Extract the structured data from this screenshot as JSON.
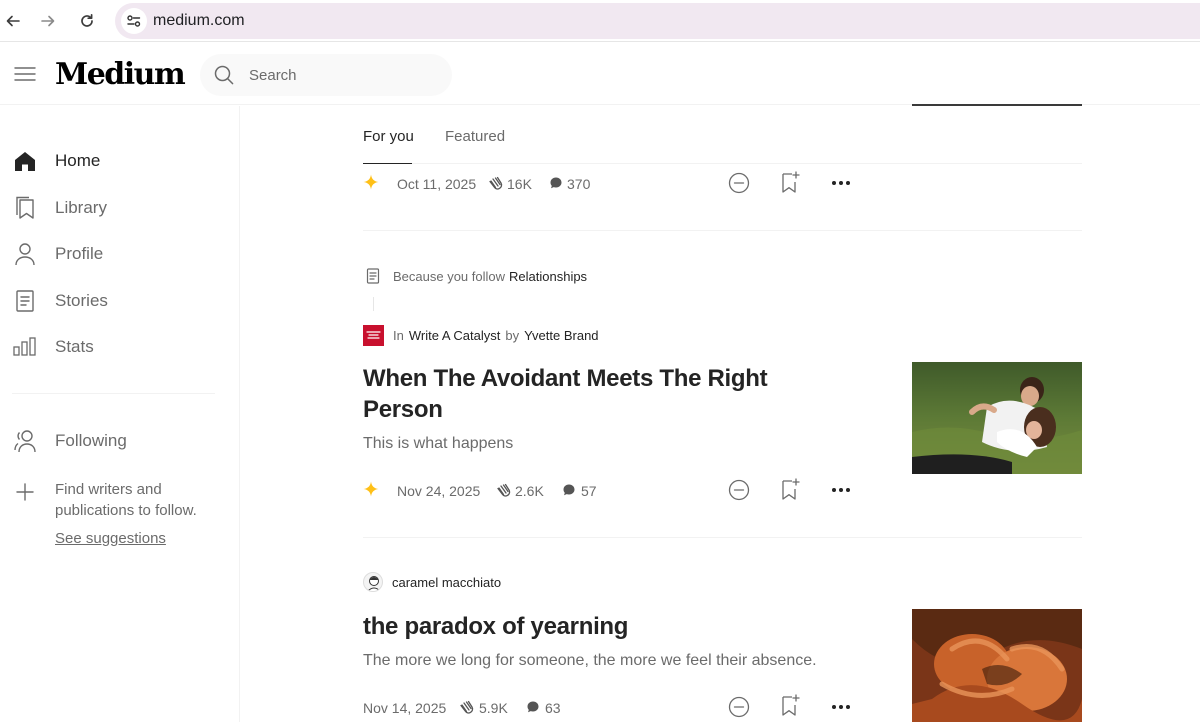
{
  "browser": {
    "url": "medium.com"
  },
  "header": {
    "logo": "Medium",
    "search_placeholder": "Search"
  },
  "sidebar": {
    "items": [
      {
        "label": "Home"
      },
      {
        "label": "Library"
      },
      {
        "label": "Profile"
      },
      {
        "label": "Stories"
      },
      {
        "label": "Stats"
      }
    ],
    "following_label": "Following",
    "find_text": "Find writers and publications to follow.",
    "see_suggestions": "See suggestions"
  },
  "tabs": [
    {
      "label": "For you",
      "active": true
    },
    {
      "label": "Featured",
      "active": false
    }
  ],
  "feed": {
    "top_item": {
      "date": "Oct 11, 2025",
      "claps": "16K",
      "responses": "370"
    },
    "articles": [
      {
        "because_prefix": "Because you follow",
        "because_topic": "Relationships",
        "in_word": "In",
        "publication": "Write A Catalyst",
        "by_word": "by",
        "author": "Yvette Brand",
        "title": "When The Avoidant Meets The Right Person",
        "subtitle": "This is what happens",
        "date": "Nov 24, 2025",
        "claps": "2.6K",
        "responses": "57"
      },
      {
        "author": "caramel macchiato",
        "title": "the paradox of yearning",
        "subtitle": "The more we long for someone, the more we feel their absence.",
        "date": "Nov 14, 2025",
        "claps": "5.9K",
        "responses": "63"
      }
    ]
  },
  "colors": {
    "accent_star": "#ffc017",
    "text_primary": "#242424",
    "text_secondary": "#6b6b6b",
    "address_bar": "#f1e8f1"
  }
}
